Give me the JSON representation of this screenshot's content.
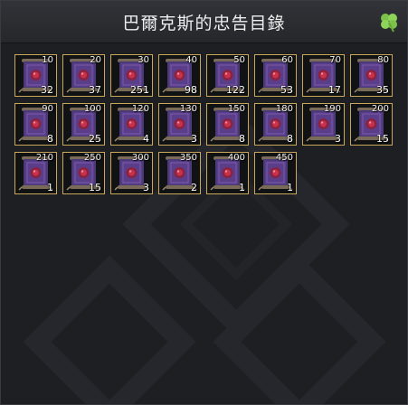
{
  "window": {
    "title": "巴爾克斯的忠告目錄"
  },
  "icons": {
    "menu": "clover-icon",
    "item": "scroll-icon"
  },
  "colors": {
    "slot_border": "#c9a85a",
    "scroll_purple": "#5a3e8a",
    "gem_red": "#c8334b"
  },
  "items": [
    {
      "level": "10",
      "count": "32"
    },
    {
      "level": "20",
      "count": "37"
    },
    {
      "level": "30",
      "count": "251"
    },
    {
      "level": "40",
      "count": "98"
    },
    {
      "level": "50",
      "count": "122"
    },
    {
      "level": "60",
      "count": "53"
    },
    {
      "level": "70",
      "count": "17"
    },
    {
      "level": "80",
      "count": "35"
    },
    {
      "level": "90",
      "count": "8"
    },
    {
      "level": "100",
      "count": "25"
    },
    {
      "level": "120",
      "count": "4"
    },
    {
      "level": "130",
      "count": "3"
    },
    {
      "level": "150",
      "count": "8"
    },
    {
      "level": "180",
      "count": "8"
    },
    {
      "level": "190",
      "count": "3"
    },
    {
      "level": "200",
      "count": "15"
    },
    {
      "level": "210",
      "count": "1"
    },
    {
      "level": "250",
      "count": "15"
    },
    {
      "level": "300",
      "count": "3"
    },
    {
      "level": "350",
      "count": "2"
    },
    {
      "level": "400",
      "count": "1"
    },
    {
      "level": "450",
      "count": "1"
    }
  ]
}
